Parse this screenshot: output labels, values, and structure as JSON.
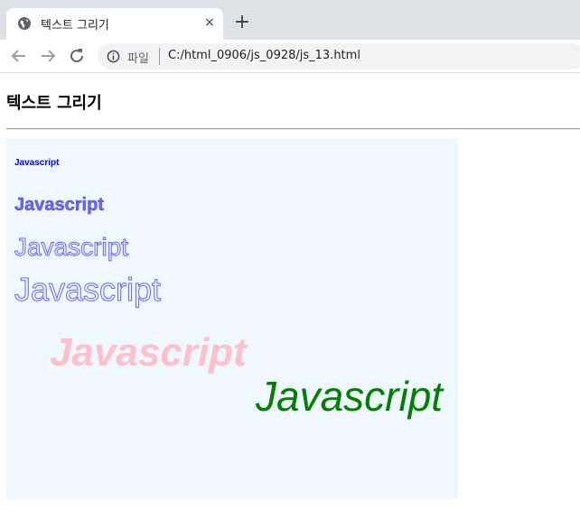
{
  "browser": {
    "tab_title": "텍스트 그리기",
    "close_glyph": "×",
    "new_tab_glyph": "+",
    "url_scheme_label": "파일",
    "url": "C:/html_0906/js_0928/js_13.html"
  },
  "page": {
    "heading": "텍스트 그리기"
  },
  "canvas": {
    "background": "#f0f8ff",
    "texts": [
      {
        "text": "Javascript",
        "color": "#0000ff",
        "style": "filled-bold"
      },
      {
        "text": "Javascript",
        "color": "#6666ff",
        "style": "filled-outlined"
      },
      {
        "text": "Javascript",
        "color": "#6666ff",
        "style": "outline"
      },
      {
        "text": "Javascript",
        "color": "#6666ff",
        "style": "outline"
      },
      {
        "text": "Javascript",
        "color": "#ffc0cb",
        "style": "filled-bold-italic"
      },
      {
        "text": "Javascript",
        "color": "#008000",
        "style": "filled-italic"
      }
    ]
  }
}
